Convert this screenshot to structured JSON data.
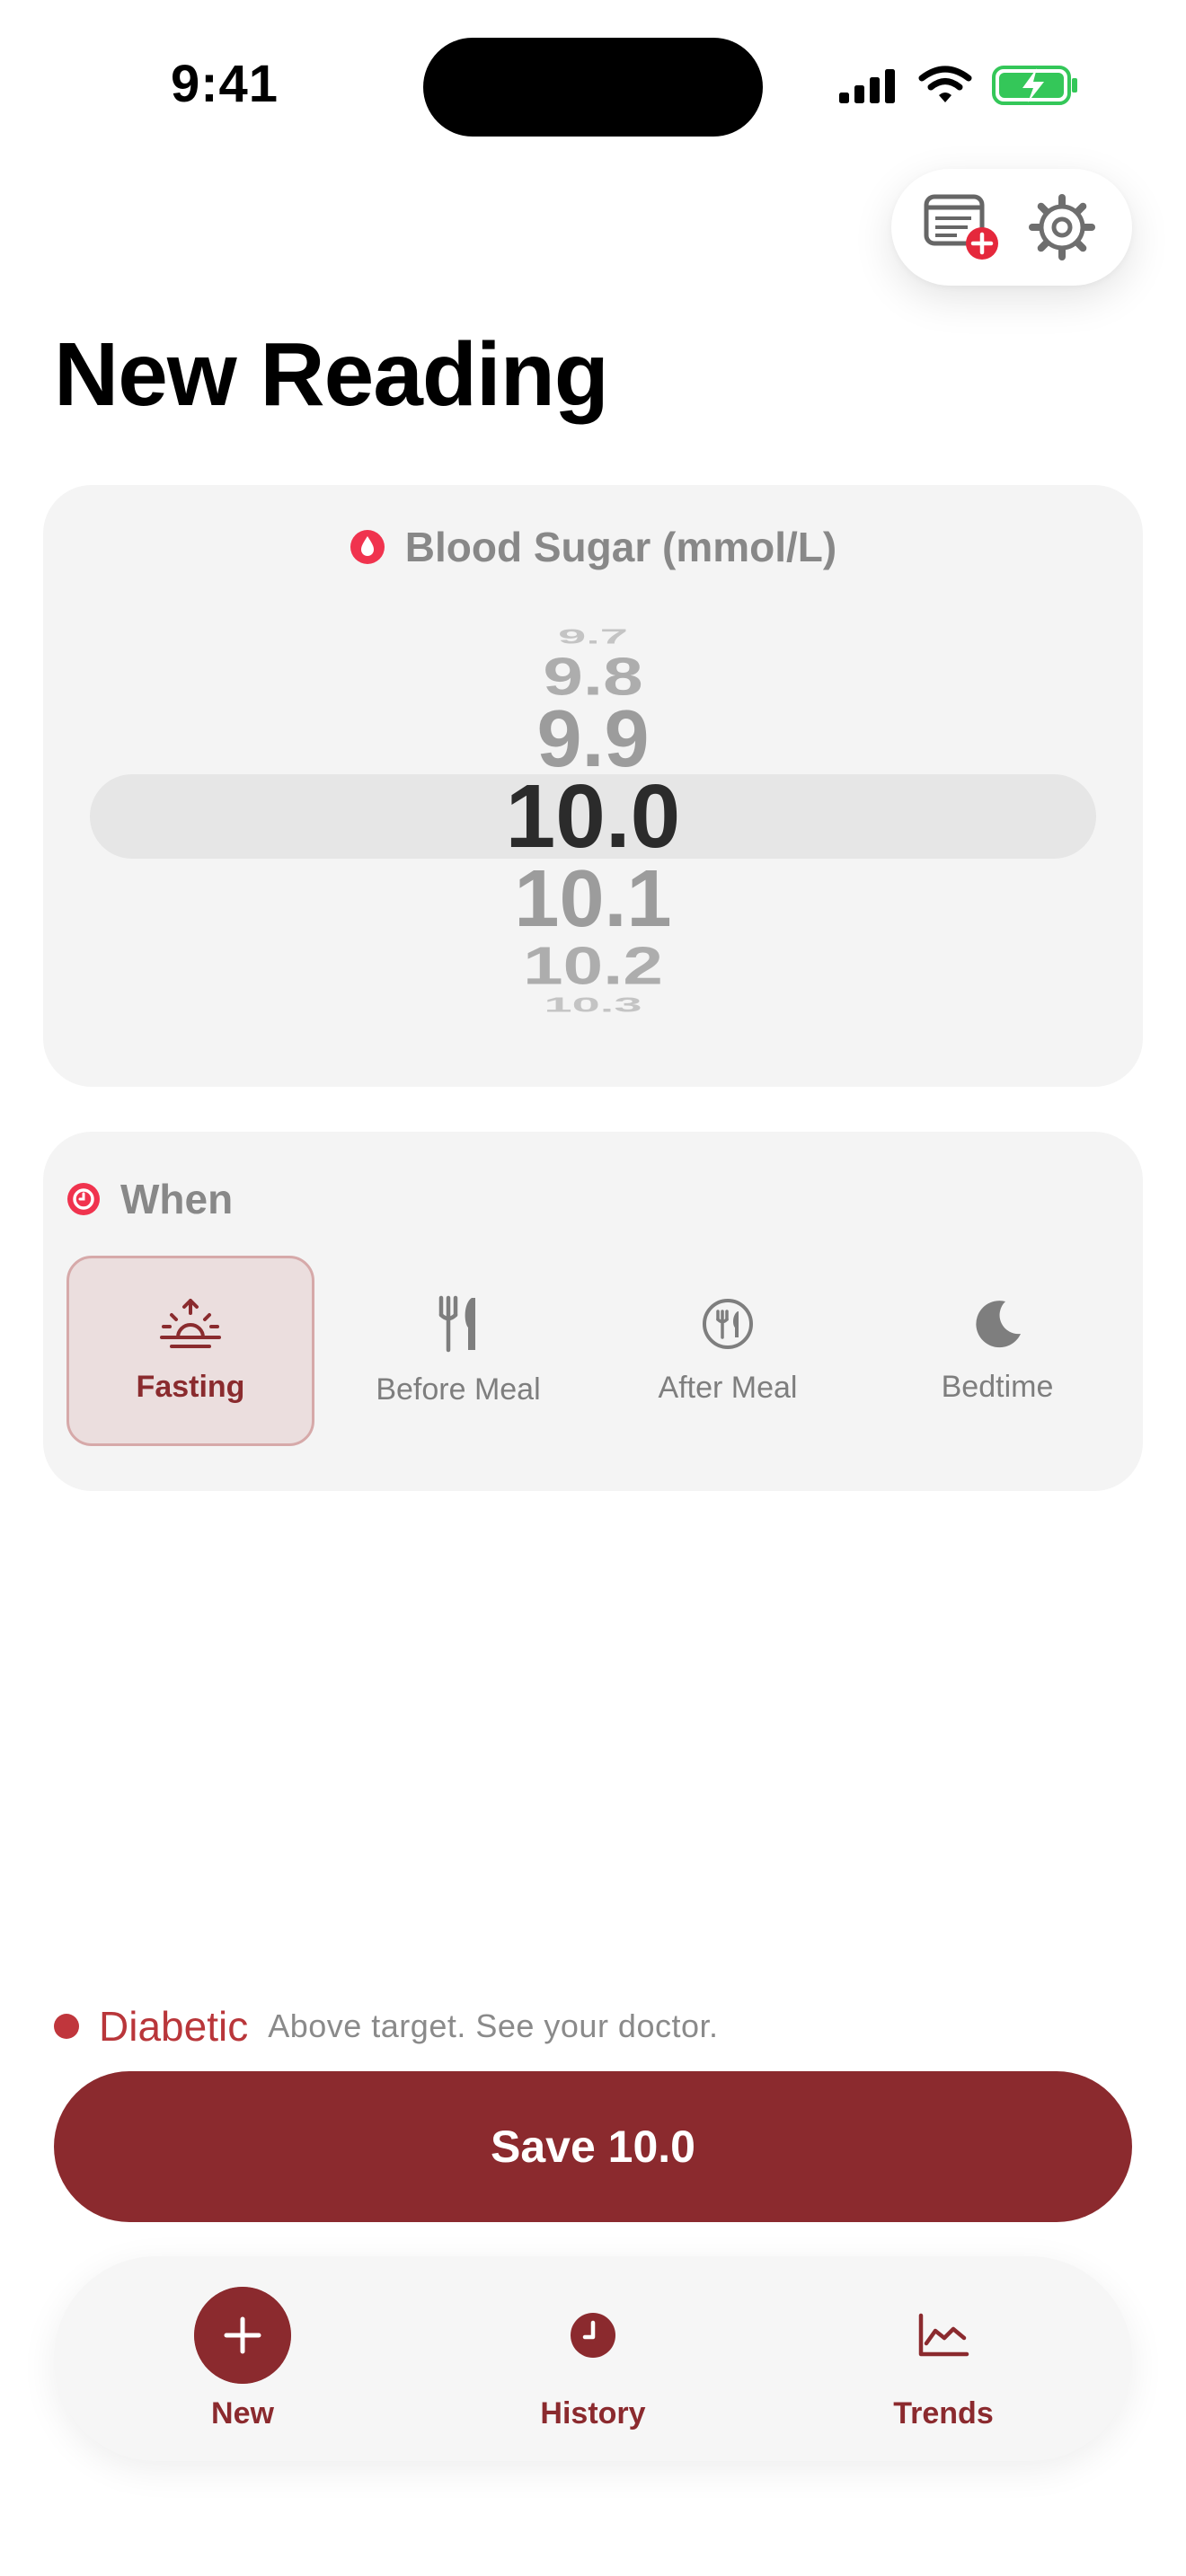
{
  "status_bar": {
    "time": "9:41"
  },
  "page": {
    "title": "New Reading"
  },
  "blood_sugar": {
    "label": "Blood Sugar (mmol/L)",
    "picker_values": [
      "9.7",
      "9.8",
      "9.9",
      "10.0",
      "10.1",
      "10.2",
      "10.3"
    ],
    "selected": "10.0"
  },
  "when": {
    "label": "When",
    "options": [
      {
        "label": "Fasting",
        "icon": "sunrise-icon",
        "selected": true
      },
      {
        "label": "Before Meal",
        "icon": "fork-knife-icon",
        "selected": false
      },
      {
        "label": "After Meal",
        "icon": "fork-knife-circle-icon",
        "selected": false
      },
      {
        "label": "Bedtime",
        "icon": "moon-icon",
        "selected": false
      }
    ]
  },
  "status": {
    "category": "Diabetic",
    "message": "Above target. See your doctor."
  },
  "save_button": {
    "label": "Save 10.0"
  },
  "tabs": [
    {
      "label": "New",
      "icon": "plus-icon",
      "active": true
    },
    {
      "label": "History",
      "icon": "clock-icon",
      "active": false
    },
    {
      "label": "Trends",
      "icon": "chart-icon",
      "active": false
    }
  ],
  "colors": {
    "accent": "#8b2a2e",
    "alert": "#c0363c",
    "drop_icon": "#f0334e",
    "card_bg": "#f4f4f4",
    "battery": "#34c759"
  }
}
